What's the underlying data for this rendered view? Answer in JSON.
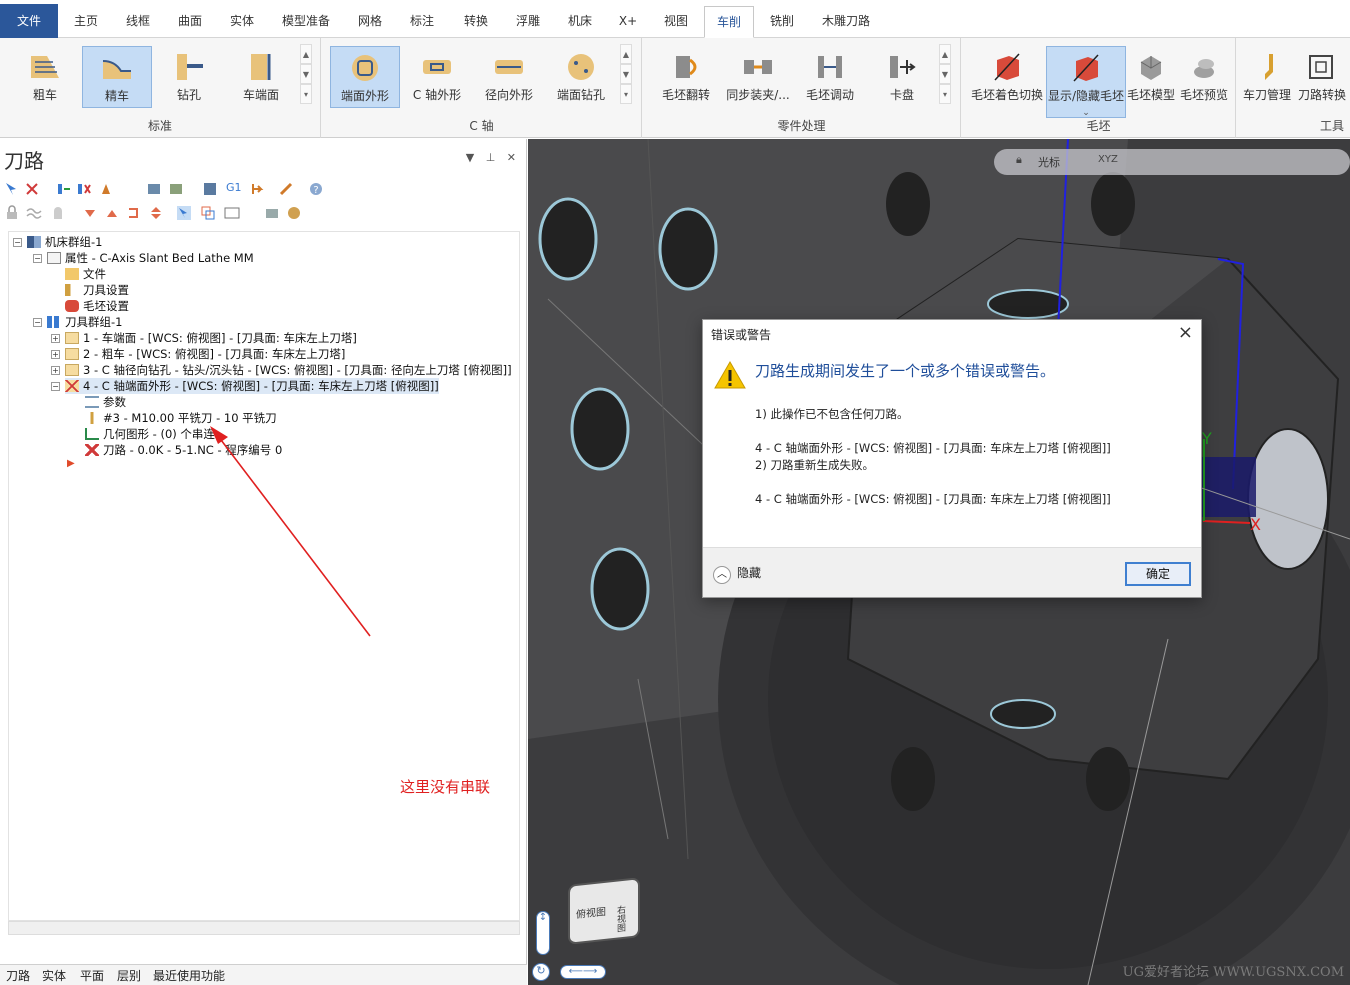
{
  "ribbon": {
    "tabs": [
      "文件",
      "主页",
      "线框",
      "曲面",
      "实体",
      "模型准备",
      "网格",
      "标注",
      "转换",
      "浮雕",
      "机床",
      "X+",
      "视图",
      "车削",
      "铣削",
      "木雕刀路"
    ],
    "active_tab": "车削",
    "groups": [
      {
        "label": "标准",
        "buttons": [
          "粗车",
          "精车",
          "钻孔",
          "车端面"
        ]
      },
      {
        "label": "C 轴",
        "buttons": [
          "端面外形",
          "C 轴外形",
          "径向外形",
          "端面钻孔"
        ]
      },
      {
        "label": "零件处理",
        "buttons": [
          "毛坯翻转",
          "同步装夹/...",
          "毛坯调动",
          "卡盘"
        ]
      },
      {
        "label": "毛坯",
        "buttons": [
          "毛坯着色切换",
          "显示/隐藏毛坯",
          "毛坯模型",
          "毛坯预览"
        ]
      },
      {
        "label": "工具",
        "buttons": [
          "车刀管理",
          "刀路转换"
        ]
      }
    ]
  },
  "panel": {
    "title": "刀路",
    "tree": [
      {
        "text": "机床群组-1"
      },
      {
        "text": "属性 - C-Axis Slant Bed Lathe MM"
      },
      {
        "text": "文件"
      },
      {
        "text": "刀具设置"
      },
      {
        "text": "毛坯设置"
      },
      {
        "text": "刀具群组-1"
      },
      {
        "text": "1 - 车端面 - [WCS: 俯视图] - [刀具面: 车床左上刀塔]"
      },
      {
        "text": "2 - 粗车 - [WCS: 俯视图] - [刀具面: 车床左上刀塔]"
      },
      {
        "text": "3 - C 轴径向钻孔 - 钻头/沉头钻 - [WCS: 俯视图] - [刀具面: 径向左上刀塔 [俯视图]]"
      },
      {
        "text": "4 - C 轴端面外形 - [WCS: 俯视图] - [刀具面: 车床左上刀塔 [俯视图]]"
      },
      {
        "text": "参数"
      },
      {
        "text": "#3 - M10.00 平铣刀 - 10 平铣刀"
      },
      {
        "text": "几何图形 - (0) 个串连"
      },
      {
        "text": "刀路 - 0.0K - 5-1.NC - 程序编号 0"
      }
    ],
    "bottom_tabs": [
      "刀路",
      "实体",
      "平面",
      "层别",
      "最近使用功能"
    ]
  },
  "viewport": {
    "toolbar_label": "光标",
    "axis_x": "X",
    "axis_y": "Y",
    "cube_labels": [
      "俯视图",
      "右视图"
    ]
  },
  "dialog": {
    "title": "错误或警告",
    "heading": "刀路生成期间发生了一个或多个错误或警告。",
    "lines": [
      "1) 此操作已不包含任何刀路。",
      "4 - C 轴端面外形 - [WCS: 俯视图] - [刀具面: 车床左上刀塔 [俯视图]]",
      "2) 刀路重新生成失败。",
      "4 - C 轴端面外形 - [WCS: 俯视图] - [刀具面: 车床左上刀塔 [俯视图]]"
    ],
    "hide_label": "隐藏",
    "ok_label": "确定"
  },
  "annotation": "这里没有串联",
  "watermark": "UG爱好者论坛 WWW.UGSNX.COM",
  "colors": {
    "accent": "#2b579a",
    "annotation": "#e02020",
    "warning": "#f5c400"
  }
}
